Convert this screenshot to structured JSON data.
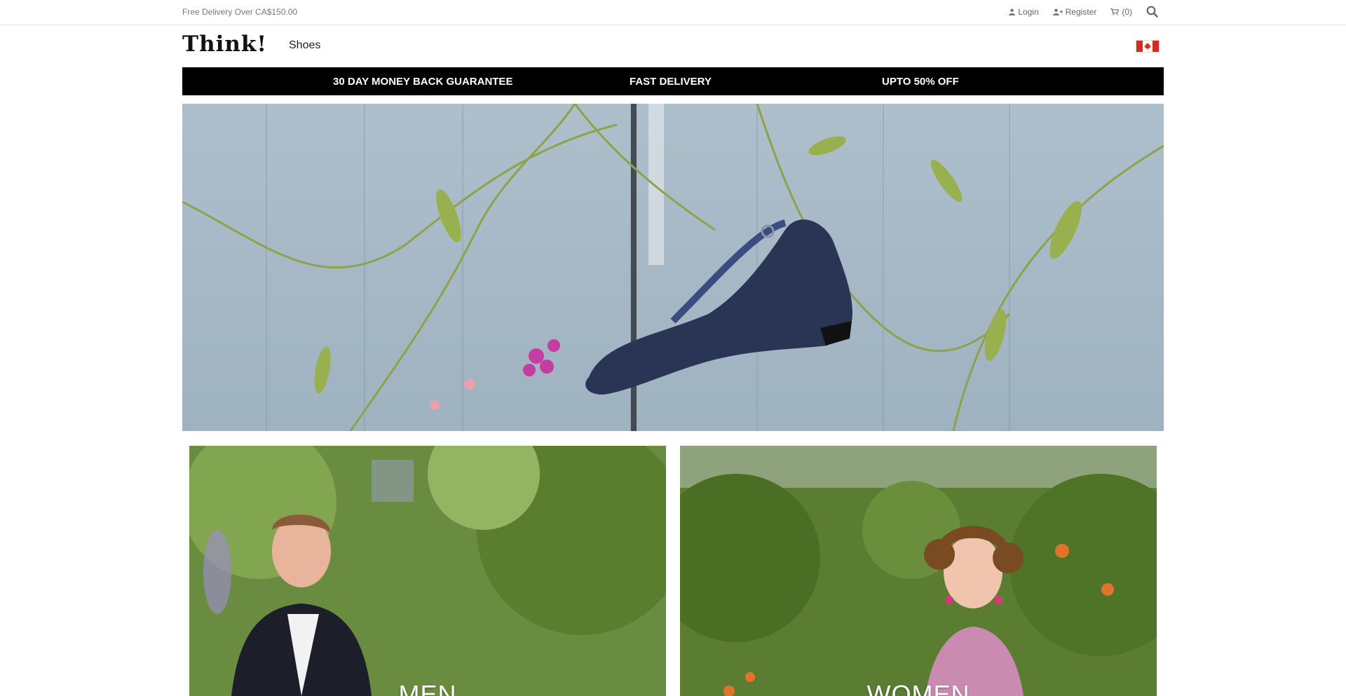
{
  "topbar": {
    "promo": "Free Delivery Over CA$150.00",
    "login": "Login",
    "register": "Register",
    "cart": "(0)"
  },
  "header": {
    "logo": "Think!",
    "nav_shoes": "Shoes",
    "country_flag": "canada-flag-icon"
  },
  "strip": {
    "items": [
      "30 DAY MONEY BACK GUARANTEE",
      "FAST DELIVERY",
      "UPTO 50% OFF"
    ]
  },
  "categories": [
    {
      "label": "MEN"
    },
    {
      "label": "WOMEN"
    }
  ],
  "colors": {
    "strip_bg": "#000000",
    "flag_red": "#d52b1e"
  }
}
